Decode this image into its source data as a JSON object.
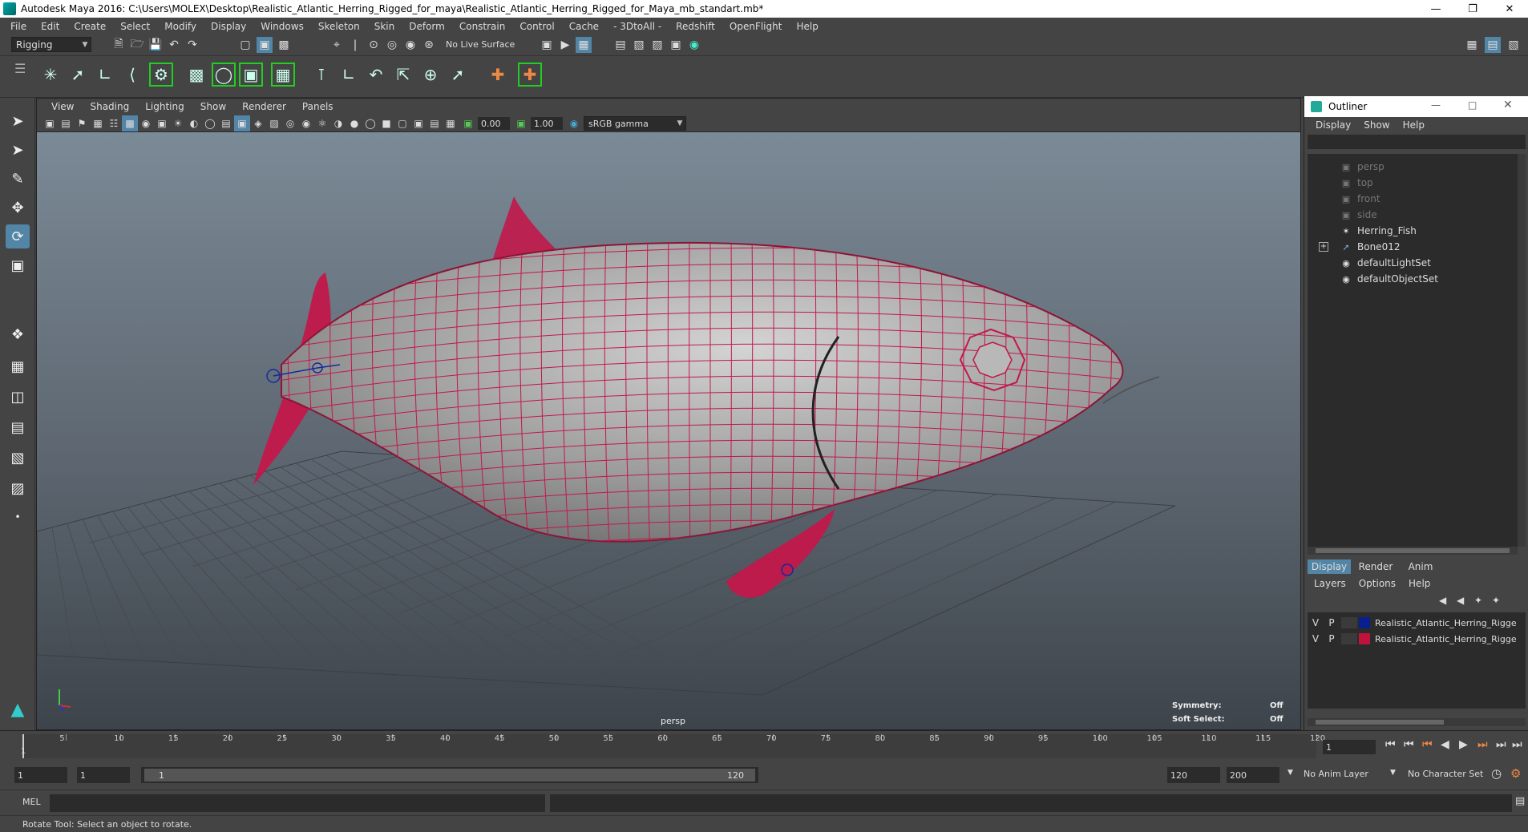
{
  "window": {
    "title": "Autodesk Maya 2016: C:\\Users\\MOLEX\\Desktop\\Realistic_Atlantic_Herring_Rigged_for_maya\\Realistic_Atlantic_Herring_Rigged_for_Maya_mb_standart.mb*"
  },
  "menubar": [
    "File",
    "Edit",
    "Create",
    "Select",
    "Modify",
    "Display",
    "Windows",
    "Skeleton",
    "Skin",
    "Deform",
    "Constrain",
    "Control",
    "Cache",
    "- 3DtoAll -",
    "Redshift",
    "OpenFlight",
    "Help"
  ],
  "statusline": {
    "mode": "Rigging",
    "live_surface": "No Live Surface"
  },
  "viewport": {
    "menus": [
      "View",
      "Shading",
      "Lighting",
      "Show",
      "Renderer",
      "Panels"
    ],
    "exposure": "0.00",
    "gamma": "1.00",
    "color_space": "sRGB gamma",
    "camera_label": "persp",
    "symmetry_label": "Symmetry:",
    "symmetry_value": "Off",
    "soft_select_label": "Soft Select:",
    "soft_select_value": "Off"
  },
  "outliner": {
    "title": "Outliner",
    "menus": [
      "Display",
      "Show",
      "Help"
    ],
    "items": [
      {
        "label": "persp",
        "icon": "camera-icon",
        "dim": true
      },
      {
        "label": "top",
        "icon": "camera-icon",
        "dim": true
      },
      {
        "label": "front",
        "icon": "camera-icon",
        "dim": true
      },
      {
        "label": "side",
        "icon": "camera-icon",
        "dim": true
      },
      {
        "label": "Herring_Fish",
        "icon": "mesh-icon",
        "dim": false
      },
      {
        "label": "Bone012",
        "icon": "joint-icon",
        "dim": false
      },
      {
        "label": "defaultLightSet",
        "icon": "set-icon",
        "dim": false
      },
      {
        "label": "defaultObjectSet",
        "icon": "set-icon",
        "dim": false
      }
    ]
  },
  "channelbox": {
    "tabs": [
      "Display",
      "Render",
      "Anim"
    ],
    "menus": [
      "Layers",
      "Options",
      "Help"
    ],
    "layers": [
      {
        "v": "V",
        "p": "P",
        "color": "#0a1f8f",
        "name": "Realistic_Atlantic_Herring_Rigge"
      },
      {
        "v": "V",
        "p": "P",
        "color": "#c0123a",
        "name": "Realistic_Atlantic_Herring_Rigge"
      }
    ]
  },
  "timeline": {
    "ticks": [
      "5",
      "10",
      "15",
      "20",
      "25",
      "30",
      "35",
      "40",
      "45",
      "50",
      "55",
      "60",
      "65",
      "70",
      "75",
      "80",
      "85",
      "90",
      "95",
      "100",
      "105",
      "110",
      "115",
      "120"
    ],
    "start_label": "1",
    "current_frame": "1"
  },
  "ranges": {
    "start": "1",
    "anim_start": "1",
    "slider_start": "1",
    "slider_end": "120",
    "playback_end": "120",
    "anim_end": "200",
    "anim_layer": "No Anim Layer",
    "character_set": "No Character Set"
  },
  "cmdline": {
    "label": "MEL"
  },
  "helpline": {
    "text": "Rotate Tool: Select an object to rotate."
  },
  "colors": {
    "wire": "#c2184a",
    "bg_ui": "#444444",
    "field": "#2b2b2b"
  }
}
